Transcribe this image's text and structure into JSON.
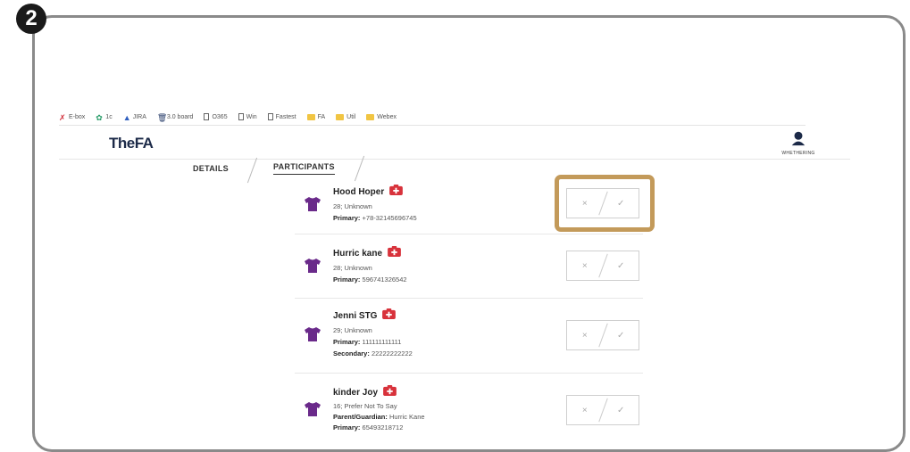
{
  "step": {
    "number": "2"
  },
  "bookmarks": [
    {
      "label": "E-box",
      "icon": "red-arrow-icon"
    },
    {
      "label": "1c",
      "icon": "green-flower-icon"
    },
    {
      "label": "JIRA",
      "icon": "jira-icon"
    },
    {
      "label": "3.0 board",
      "icon": "trash-icon"
    },
    {
      "label": "O365",
      "icon": "document-icon"
    },
    {
      "label": "Win",
      "icon": "document-icon"
    },
    {
      "label": "Fastest",
      "icon": "document-icon"
    },
    {
      "label": "FA",
      "icon": "folder-icon"
    },
    {
      "label": "Util",
      "icon": "folder-icon"
    },
    {
      "label": "Webex",
      "icon": "folder-icon"
    }
  ],
  "header": {
    "logo": "TheFA",
    "user_name": "WHETHERING"
  },
  "tabs": {
    "details": "DETAILS",
    "participants": "PARTICIPANTS"
  },
  "participants": [
    {
      "name": "Hood Hoper",
      "line1": "28; Unknown",
      "lines": [
        {
          "label": "Primary:",
          "value": " +78-32145696745"
        }
      ]
    },
    {
      "name": "Hurric kane",
      "line1": "28; Unknown",
      "lines": [
        {
          "label": "Primary:",
          "value": " 596741326542"
        }
      ]
    },
    {
      "name": "Jenni STG",
      "line1": "29; Unknown",
      "lines": [
        {
          "label": "Primary:",
          "value": " 111111111111"
        },
        {
          "label": "Secondary:",
          "value": " 22222222222"
        }
      ]
    },
    {
      "name": "kinder Joy",
      "line1": "16; Prefer Not To Say",
      "lines": [
        {
          "label": "Parent/Guardian:",
          "value": " Hurric Kane"
        },
        {
          "label": "Primary:",
          "value": " 65493218712"
        }
      ]
    }
  ],
  "response": {
    "decline": "×",
    "accept": "✓"
  },
  "colors": {
    "shirt": "#6a2a8a",
    "medical": "#d8323b",
    "highlight": "#c39a5a"
  }
}
